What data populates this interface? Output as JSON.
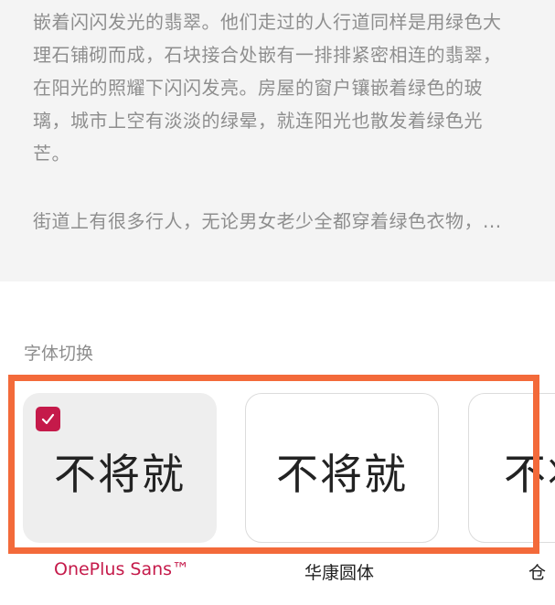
{
  "preview": {
    "paragraph1": "嵌着闪闪发光的翡翠。他们走过的人行道同样是用绿色大理石铺砌而成，石块接合处嵌有一排排紧密相连的翡翠，在阳光的照耀下闪闪发亮。房屋的窗户镶嵌着绿色的玻璃，城市上空有淡淡的绿晕，就连阳光也散发着绿色光芒。",
    "paragraph2": "街道上有很多行人，无论男女老少全都穿着绿色衣物，..."
  },
  "font_section": {
    "label": "字体切换",
    "fonts": [
      {
        "sample": "不将就",
        "name": "OnePlus Sans™",
        "selected": true
      },
      {
        "sample": "不将就",
        "name": "华康圆体",
        "selected": false
      },
      {
        "sample": "不将就",
        "name": "仓",
        "selected": false
      }
    ]
  },
  "colors": {
    "accent": "#c51a4a",
    "highlight_frame": "#f36a3a",
    "preview_background": "#f4f4f4",
    "muted_text": "#8e8e8e"
  },
  "icons": {
    "selected_check": "checkmark-icon"
  }
}
